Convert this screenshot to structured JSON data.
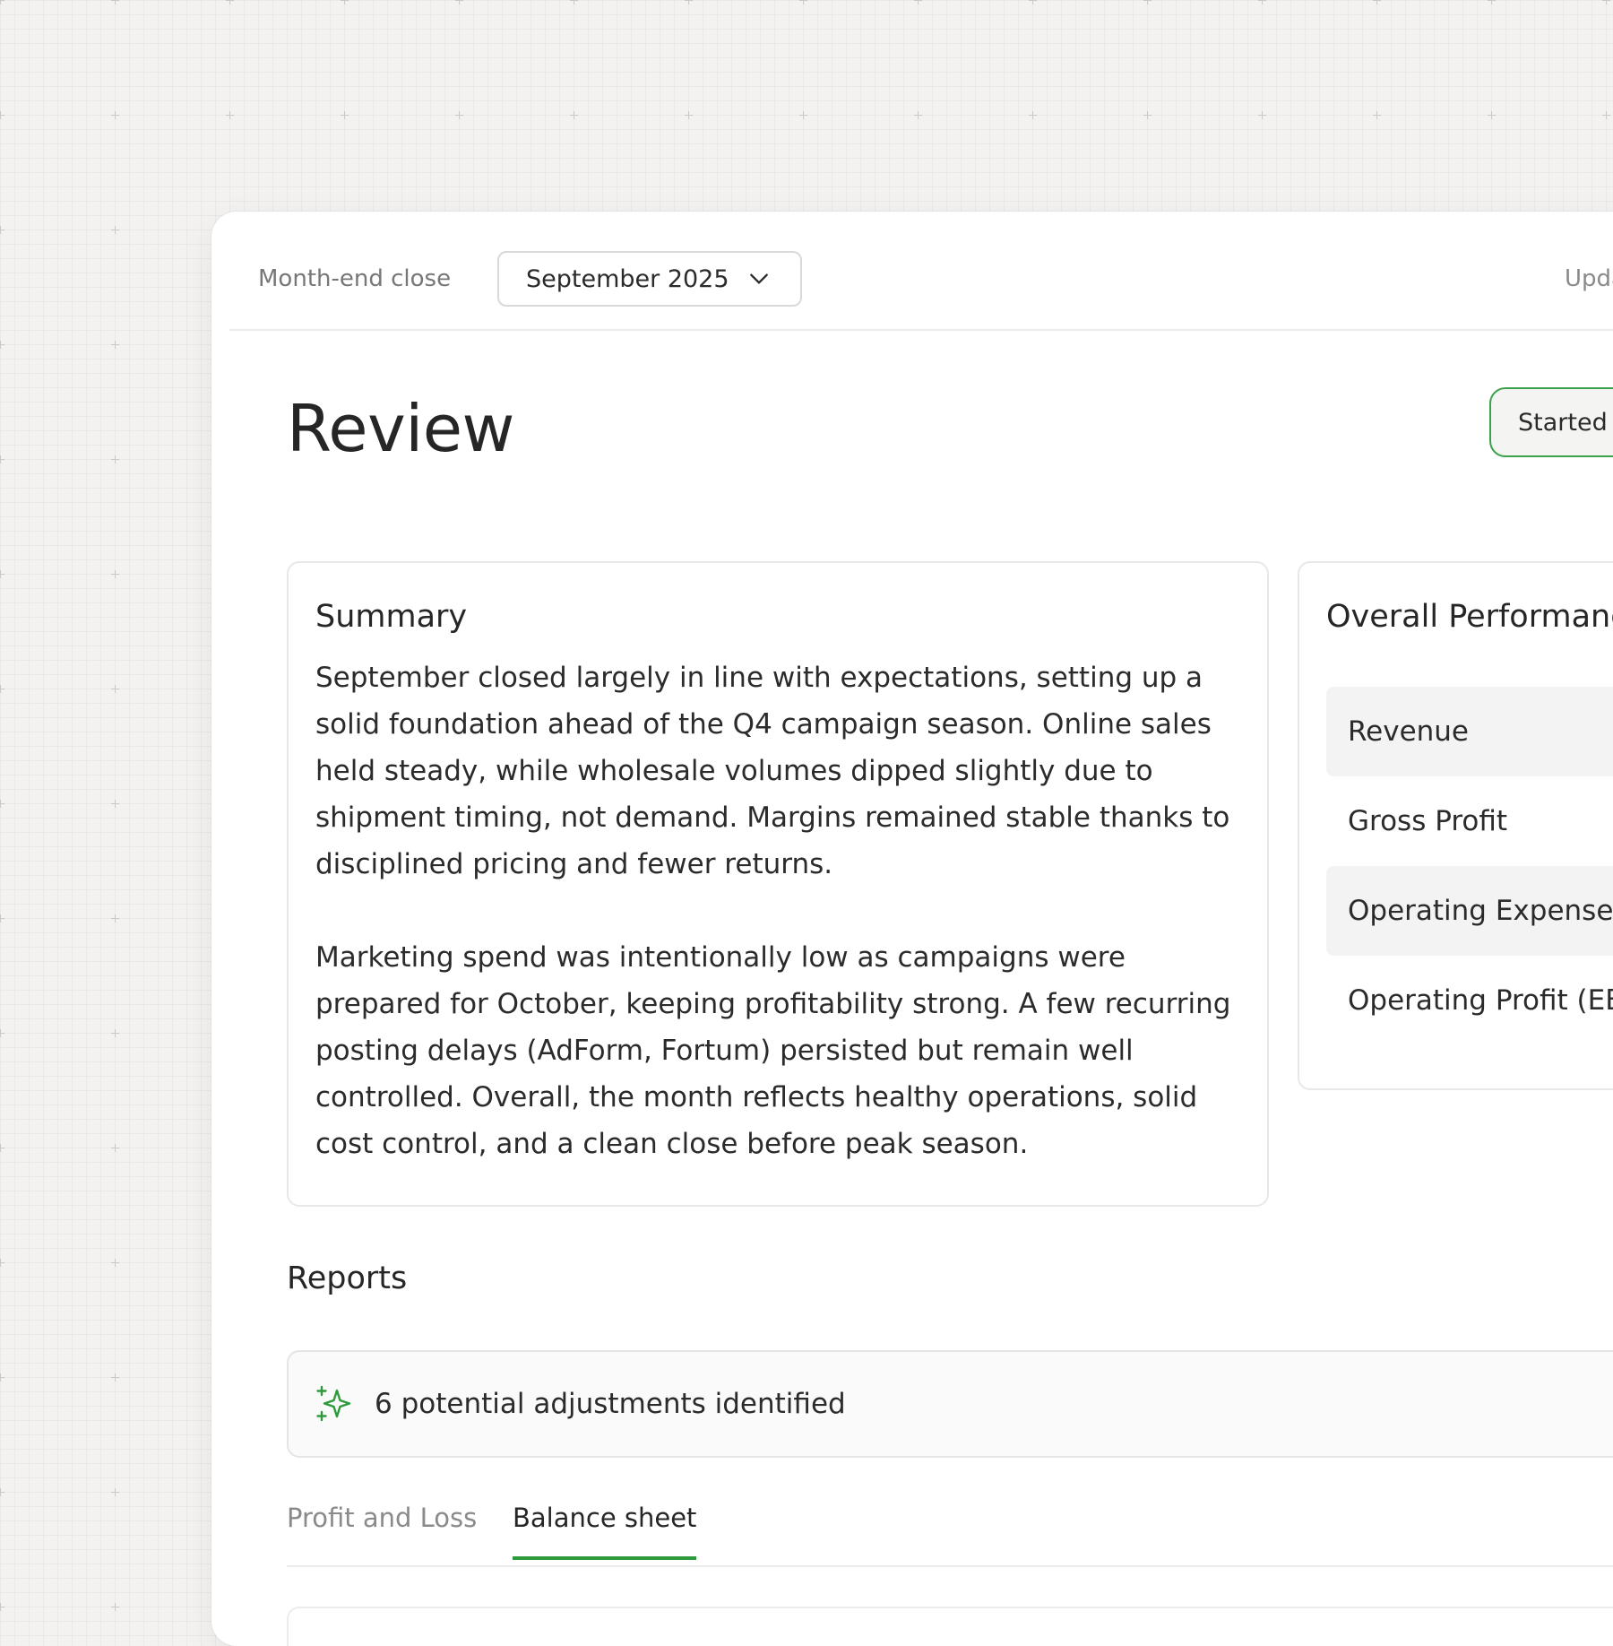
{
  "header": {
    "close_label": "Month-end close",
    "period_select": {
      "value": "September 2025"
    },
    "updated_label": "Upda"
  },
  "page": {
    "title": "Review",
    "status_badge": "Started"
  },
  "summary": {
    "title": "Summary",
    "paragraphs": [
      "September closed largely in line with expectations, setting up a solid foundation ahead of the Q4 campaign season. Online sales held steady, while wholesale volumes dipped slightly due to shipment timing, not demand. Margins remained stable thanks to disciplined pricing and fewer returns.",
      "Marketing spend was intentionally low as campaigns were prepared for October, keeping profitability strong. A few recurring posting delays (AdForm, Fortum) persisted but remain well controlled. Overall, the month reflects healthy operations, solid cost control, and a clean close before peak season."
    ]
  },
  "performance": {
    "title": "Overall Performanc",
    "rows": [
      {
        "label": "Revenue"
      },
      {
        "label": "Gross Profit"
      },
      {
        "label": "Operating Expenses"
      },
      {
        "label": "Operating Profit (EB"
      }
    ]
  },
  "reports": {
    "title": "Reports",
    "adjustments_text": "6 potential adjustments identified",
    "tabs": [
      {
        "label": "Profit and Loss",
        "active": false
      },
      {
        "label": "Balance sheet",
        "active": true
      }
    ]
  },
  "colors": {
    "accent_green": "#2e9a3c",
    "badge_border": "#3aa24a"
  },
  "icons": {
    "period_select": "chevron-down-icon",
    "adjustments": "sparkle-icon"
  }
}
